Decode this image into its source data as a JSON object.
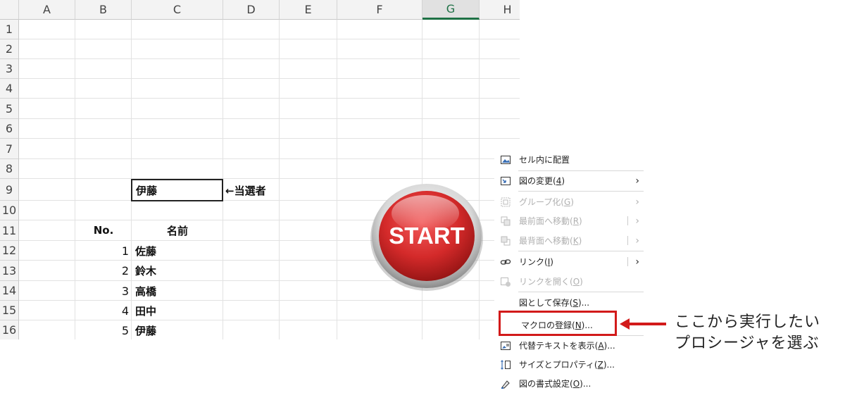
{
  "columns": [
    "A",
    "B",
    "C",
    "D",
    "E",
    "F",
    "G",
    "H"
  ],
  "selected_column": "G",
  "rows": [
    "1",
    "2",
    "3",
    "4",
    "5",
    "6",
    "7",
    "8",
    "9",
    "10",
    "11",
    "12",
    "13",
    "14",
    "15",
    "16"
  ],
  "cells": {
    "C9": "伊藤",
    "D9_note": "←当選者",
    "B11": "No.",
    "C11": "名前",
    "list": [
      {
        "no": "1",
        "name": "佐藤"
      },
      {
        "no": "2",
        "name": "鈴木"
      },
      {
        "no": "3",
        "name": "高橋"
      },
      {
        "no": "4",
        "name": "田中"
      },
      {
        "no": "5",
        "name": "伊藤"
      }
    ]
  },
  "start_button": {
    "label": "START",
    "color": "#d42a2a"
  },
  "context_menu": {
    "items": [
      {
        "label": "セル内に配置",
        "icon": "place-in-cell-icon",
        "enabled": true
      },
      {
        "label": "図の変更(4)",
        "hotkey": "4",
        "icon": "change-picture-icon",
        "enabled": true,
        "submenu": true
      },
      {
        "label": "グループ化(G)",
        "hotkey": "G",
        "icon": "group-icon",
        "enabled": false,
        "submenu": true
      },
      {
        "label": "最前面へ移動(R)",
        "hotkey": "R",
        "icon": "bring-to-front-icon",
        "enabled": false,
        "submenu": true
      },
      {
        "label": "最背面へ移動(K)",
        "hotkey": "K",
        "icon": "send-to-back-icon",
        "enabled": false,
        "submenu": true
      },
      {
        "label": "リンク(I)",
        "hotkey": "I",
        "icon": "link-icon",
        "enabled": true,
        "submenu": true
      },
      {
        "label": "リンクを開く(O)",
        "hotkey": "O",
        "icon": "open-link-icon",
        "enabled": false
      },
      {
        "label": "図として保存(S)...",
        "hotkey": "S",
        "enabled": true
      },
      {
        "label": "マクロの登録(N)...",
        "hotkey": "N",
        "enabled": true
      },
      {
        "label": "代替テキストを表示(A)...",
        "hotkey": "A",
        "icon": "alt-text-icon",
        "enabled": true
      },
      {
        "label": "サイズとプロパティ(Z)...",
        "hotkey": "Z",
        "icon": "size-properties-icon",
        "enabled": true
      },
      {
        "label": "図の書式設定(O)...",
        "hotkey": "O",
        "icon": "format-picture-icon",
        "enabled": true
      }
    ]
  },
  "callout": {
    "line1": "ここから実行したい",
    "line2": "プロシージャを選ぶ",
    "color": "#d21a1a"
  }
}
